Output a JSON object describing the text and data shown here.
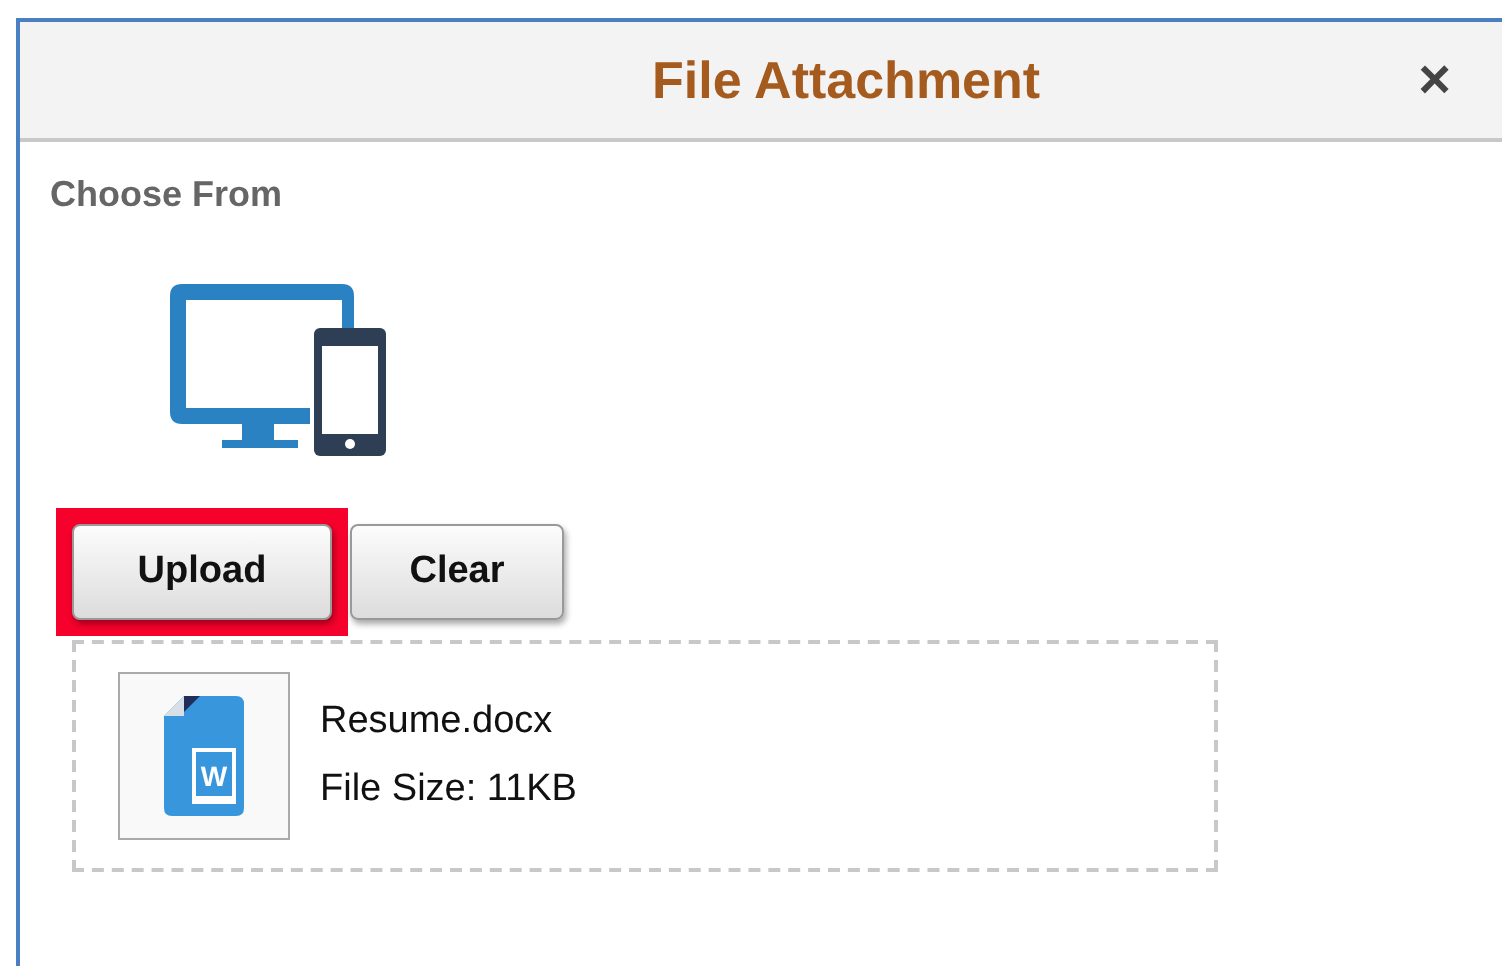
{
  "dialog": {
    "title": "File Attachment",
    "close": "×"
  },
  "section_label": "Choose From",
  "buttons": [
    {
      "label": "Upload",
      "highlighted": true
    },
    {
      "label": "Clear",
      "highlighted": false
    }
  ],
  "attachment": {
    "icon_letter": "W",
    "name": "Resume.docx",
    "size": "File Size: 11KB"
  }
}
